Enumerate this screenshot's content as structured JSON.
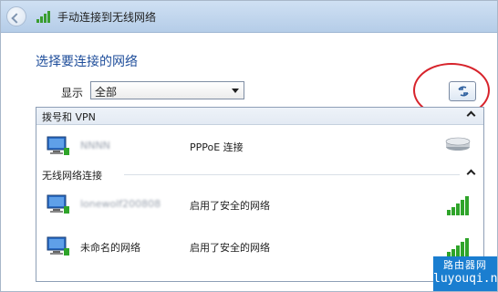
{
  "window": {
    "title": "手动连接到无线网络"
  },
  "heading": "选择要连接的网络",
  "filter": {
    "label": "显示",
    "value": "全部"
  },
  "groups": [
    {
      "label": "拨号和 VPN"
    },
    {
      "label": "无线网络连接"
    }
  ],
  "networks": [
    {
      "name": "NNNN",
      "status": "PPPoE 连接",
      "icon": "modem-icon"
    },
    {
      "name": "lonewolf200808",
      "status": "启用了安全的网络",
      "icon": "wifi-signal-icon"
    },
    {
      "name": "未命名的网络",
      "status": "启用了安全的网络",
      "icon": "wifi-signal-icon"
    }
  ],
  "watermark": {
    "top": "路由器网",
    "bottom": "luyouqi.net"
  },
  "colors": {
    "accent": "#1f4e9b",
    "annotation": "#d7232b",
    "signal": "#2fa42a",
    "watermark": "#1a7ed0"
  }
}
